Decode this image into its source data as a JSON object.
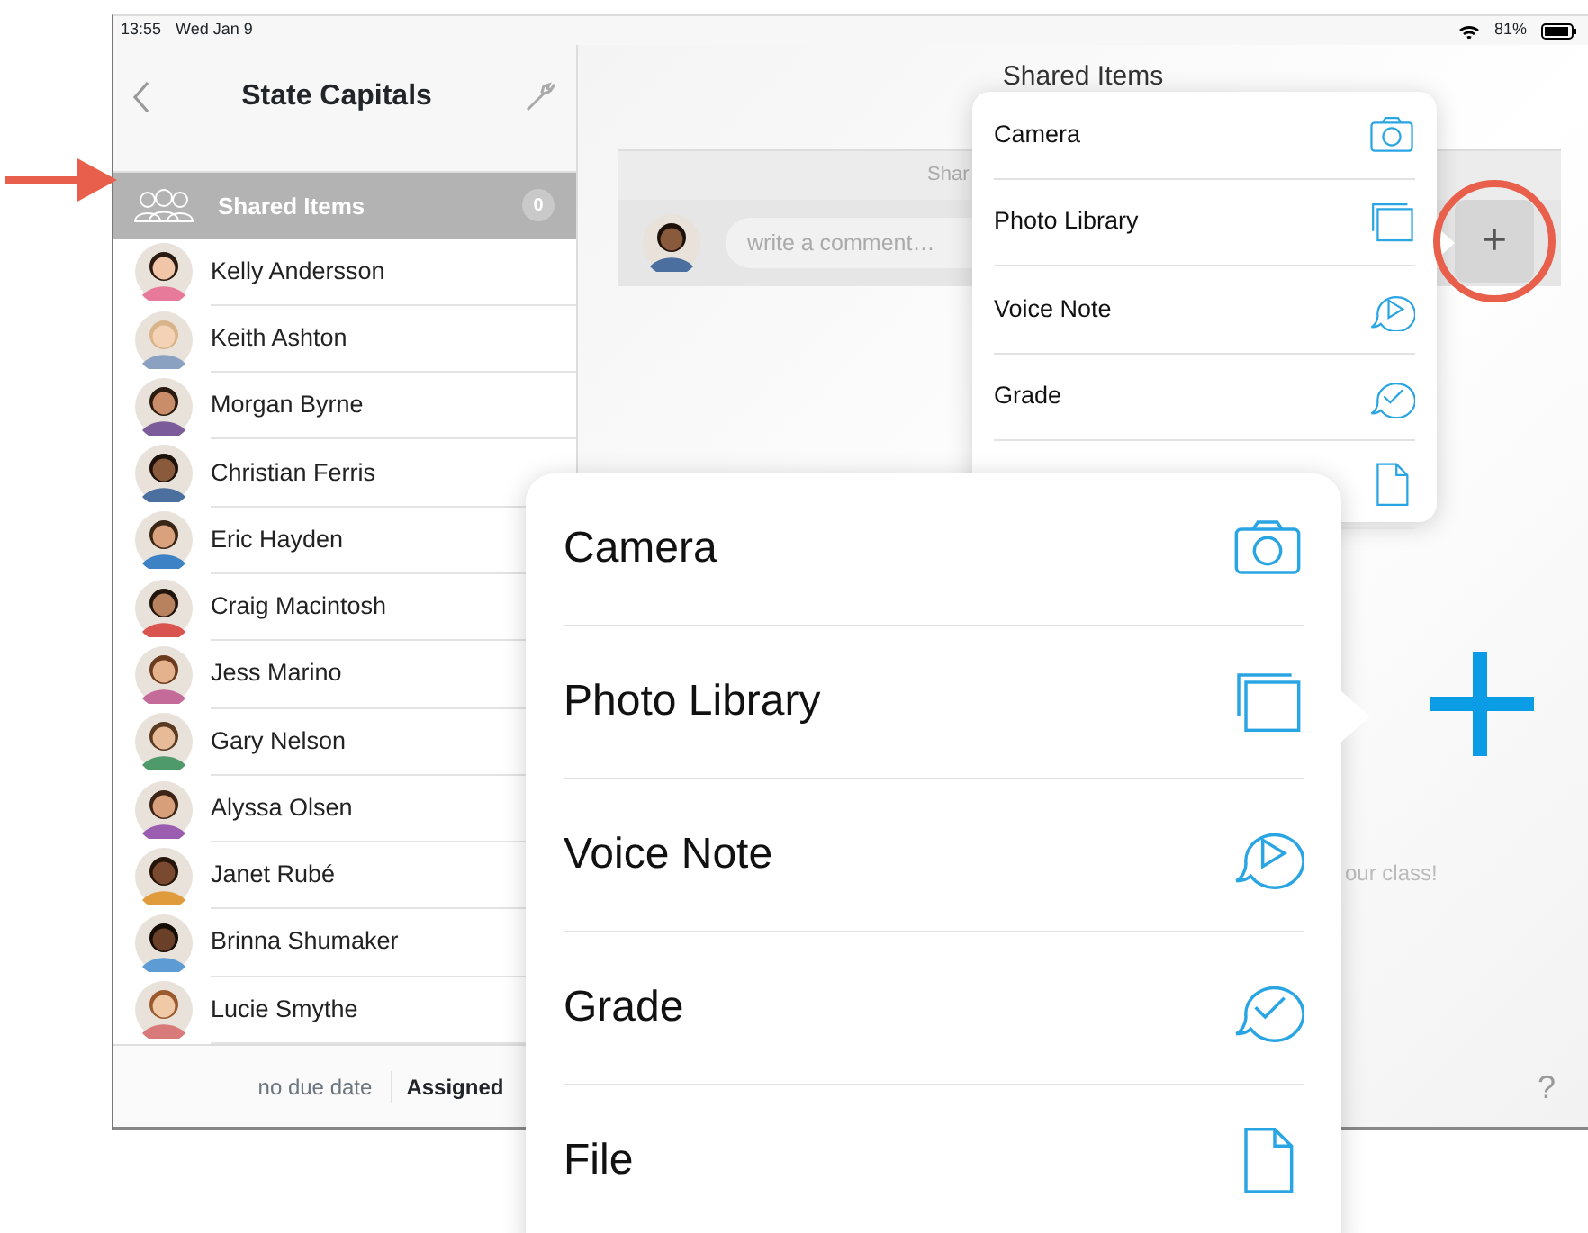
{
  "status_bar": {
    "time": "13:55",
    "date": "Wed Jan 9",
    "battery": "81%"
  },
  "sidebar": {
    "title": "State Capitals",
    "shared_items": {
      "label": "Shared Items",
      "count": "0",
      "selected": true
    },
    "students": [
      {
        "name": "Kelly Andersson",
        "selected": false
      },
      {
        "name": "Keith Ashton",
        "selected": false
      },
      {
        "name": "Morgan Byrne",
        "selected": false
      },
      {
        "name": "Christian Ferris",
        "selected": false
      },
      {
        "name": "Eric Hayden",
        "selected": false
      },
      {
        "name": "Craig Macintosh",
        "selected": false
      },
      {
        "name": "Jess Marino",
        "selected": false
      },
      {
        "name": "Gary Nelson",
        "selected": false
      },
      {
        "name": "Alyssa Olsen",
        "selected": false
      },
      {
        "name": "Janet Rubé",
        "selected": false
      },
      {
        "name": "Brinna Shumaker",
        "selected": false
      },
      {
        "name": "Lucie Smythe",
        "selected": false
      }
    ],
    "footer": {
      "due": "no due date",
      "status": "Assigned"
    }
  },
  "main": {
    "title": "Shared Items",
    "tab": "Shar",
    "add_button": "+",
    "comment": {
      "placeholder": "write a comment…"
    },
    "empty_message": "our class!",
    "help": "?"
  },
  "add_menu": {
    "items": [
      {
        "kind": "camera",
        "label": "Camera"
      },
      {
        "kind": "photos",
        "label": "Photo Library"
      },
      {
        "kind": "voice",
        "label": "Voice Note"
      },
      {
        "kind": "grade",
        "label": "Grade"
      },
      {
        "kind": "file"
      }
    ]
  },
  "add_menu_zoomed": {
    "items": [
      {
        "kind": "camera",
        "label": "Camera"
      },
      {
        "kind": "photos",
        "label": "Photo Library"
      },
      {
        "kind": "voice",
        "label": "Voice Note"
      },
      {
        "kind": "grade",
        "label": "Grade"
      },
      {
        "kind": "file",
        "label": "File"
      }
    ]
  }
}
